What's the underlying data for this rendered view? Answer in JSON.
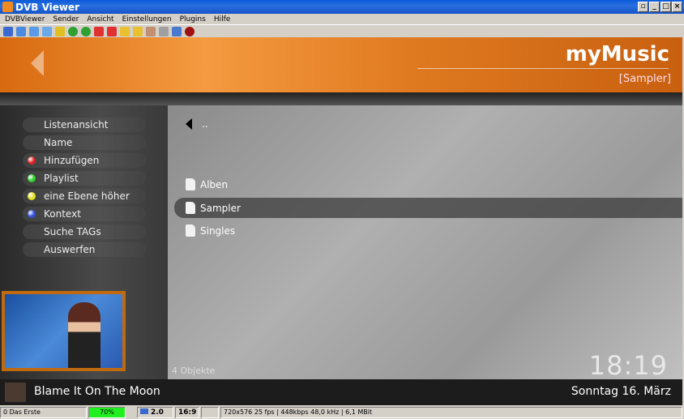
{
  "window": {
    "title": "DVB Viewer"
  },
  "menu": [
    "DVBViewer",
    "Sender",
    "Ansicht",
    "Einstellungen",
    "Plugins",
    "Hilfe"
  ],
  "header": {
    "title": "myMusic",
    "subtitle": "[Sampler]"
  },
  "sidebar": [
    {
      "label": "Listenansicht",
      "color": ""
    },
    {
      "label": "Name",
      "color": ""
    },
    {
      "label": "Hinzufügen",
      "color": "#e02020"
    },
    {
      "label": "Playlist",
      "color": "#30d030"
    },
    {
      "label": "eine Ebene höher",
      "color": "#e0e020"
    },
    {
      "label": "Kontext",
      "color": "#3050e0"
    },
    {
      "label": "Suche TAGs",
      "color": ""
    },
    {
      "label": "Auswerfen",
      "color": ""
    }
  ],
  "list": [
    {
      "label": ".."
    },
    {
      "label": "Alben"
    },
    {
      "label": "Sampler",
      "selected": true
    },
    {
      "label": "Singles"
    }
  ],
  "footer": {
    "count": "4 Objekte",
    "clock": "18:19",
    "now_playing": "Blame It On The Moon",
    "date": "Sonntag 16. März"
  },
  "status": {
    "channel": "0 Das Erste",
    "signal": "70%",
    "audio": "2.0",
    "aspect": "16:9",
    "info": "720x576 25 fps | 448kbps 48,0 kHz | 6,1 MBit"
  }
}
